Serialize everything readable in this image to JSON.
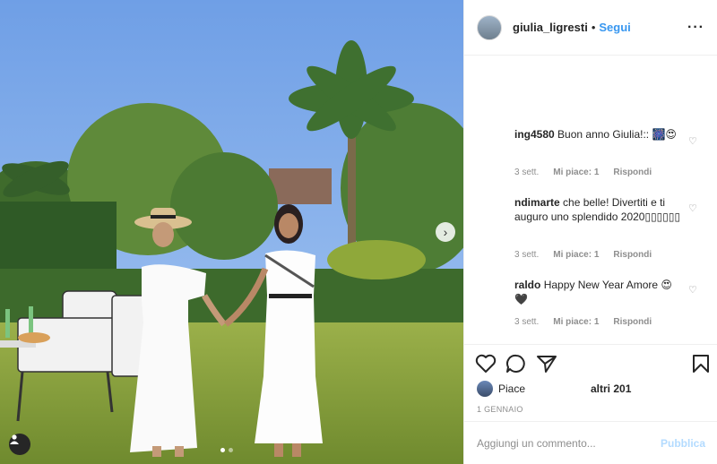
{
  "post": {
    "username": "giulia_ligresti",
    "separator": "•",
    "follow_label": "Segui",
    "more_label": "···",
    "next_label": "›"
  },
  "comments": [
    {
      "user": "ing4580",
      "text": "Buon anno Giulia!:: 🎆😍",
      "age": "3 sett.",
      "likes": "Mi piace: 1",
      "reply": "Rispondi"
    },
    {
      "user": "ndimarte",
      "text": "che belle! Divertiti e ti auguro uno splendido 2020▯▯▯▯▯▯",
      "age": "3 sett.",
      "likes": "Mi piace: 1",
      "reply": "Rispondi"
    },
    {
      "user": "raldo",
      "text": "Happy New Year Amore 😍🖤",
      "age": "3 sett.",
      "likes": "Mi piace: 1",
      "reply": "Rispondi"
    }
  ],
  "footer": {
    "liked_by": "Piace",
    "likes_count": "altri 201",
    "date": "1 GENNAIO",
    "comment_placeholder": "Aggiungi un commento...",
    "publish_label": "Pubblica"
  },
  "icons": [
    "heart-icon",
    "comment-icon",
    "share-icon",
    "bookmark-icon",
    "user-tag-icon",
    "chevron-right-icon"
  ],
  "colors": {
    "accent": "#3897f0",
    "publish_disabled": "#b3dbff",
    "muted": "#8e8e8e"
  },
  "carousel": {
    "slides": 2,
    "active_index": 1
  }
}
